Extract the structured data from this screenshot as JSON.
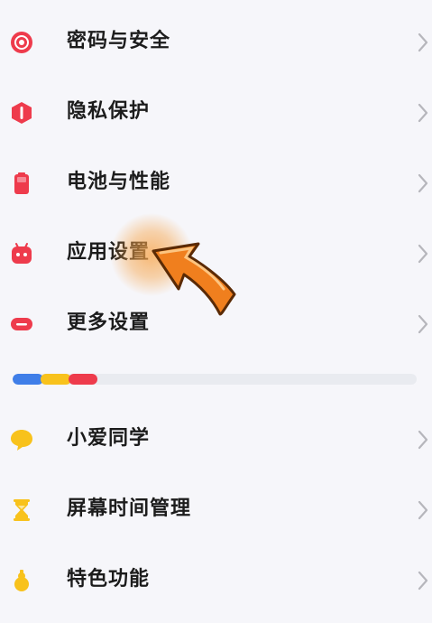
{
  "colors": {
    "background": "#f6f6fa",
    "text": "#1c1c1c",
    "chevron": "#b6b6bc",
    "red_icon": "#ee3b4c",
    "yellow_icon": "#f8c21c",
    "blue_segment": "#3f7ee8",
    "yellow_segment": "#f8c21c",
    "red_segment": "#ee3b4c",
    "track": "#e9ebf0",
    "pointer_orange": "#f07f1e",
    "pointer_glow": "#f7a347"
  },
  "settings": {
    "group1": [
      {
        "id": "password-security",
        "label": "密码与安全",
        "icon": "lock-target-icon"
      },
      {
        "id": "privacy",
        "label": "隐私保护",
        "icon": "shield-hexagon-icon"
      },
      {
        "id": "battery-performance",
        "label": "电池与性能",
        "icon": "battery-icon"
      },
      {
        "id": "app-settings",
        "label": "应用设置",
        "icon": "android-robot-icon"
      },
      {
        "id": "more-settings",
        "label": "更多设置",
        "icon": "pill-icon"
      }
    ],
    "group2": [
      {
        "id": "xiaoai",
        "label": "小爱同学",
        "icon": "chat-bubble-icon"
      },
      {
        "id": "screen-time",
        "label": "屏幕时间管理",
        "icon": "hourglass-icon"
      },
      {
        "id": "special-features",
        "label": "特色功能",
        "icon": "gourd-icon"
      }
    ]
  }
}
